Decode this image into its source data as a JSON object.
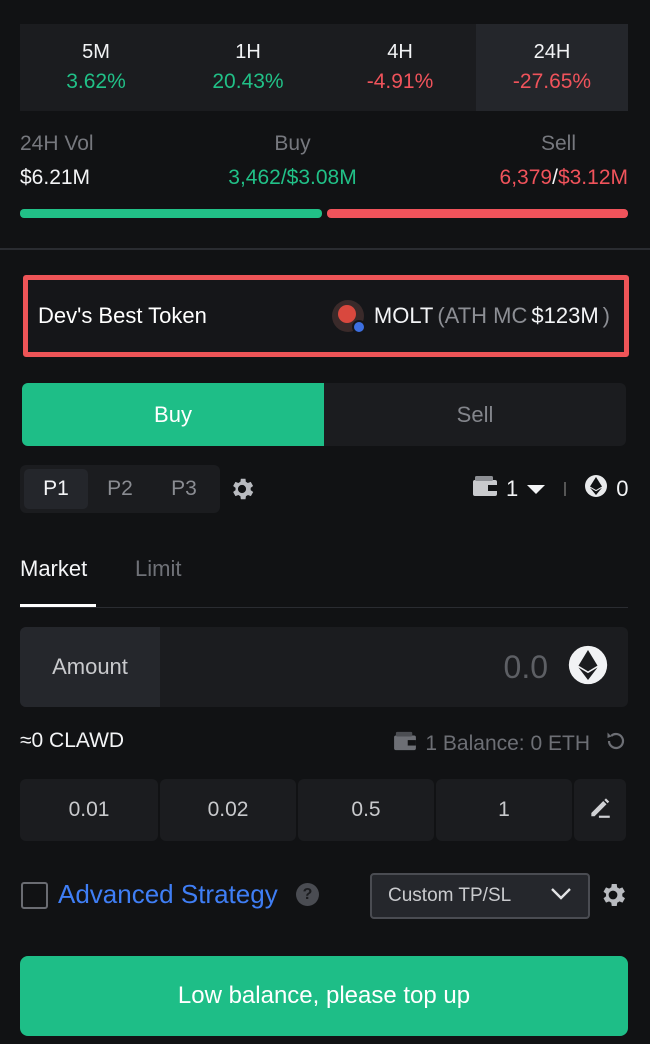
{
  "timeframes": [
    {
      "label": "5M",
      "change": "3.62%",
      "trend": "up"
    },
    {
      "label": "1H",
      "change": "20.43%",
      "trend": "up"
    },
    {
      "label": "4H",
      "change": "-4.91%",
      "trend": "down"
    },
    {
      "label": "24H",
      "change": "-27.65%",
      "trend": "down",
      "active": true
    }
  ],
  "volume": {
    "vol_label": "24H Vol",
    "vol_value": "$6.21M",
    "buy_label": "Buy",
    "buy_count": "3,462",
    "buy_sep": "/",
    "buy_amount": "$3.08M",
    "sell_label": "Sell",
    "sell_count": "6,379",
    "sell_sep": "/",
    "sell_amount": "$3.12M",
    "buy_share": 0.497
  },
  "best_token": {
    "title": "Dev's Best Token",
    "symbol": "MOLT",
    "ath_prefix": "(ATH MC",
    "ath_value": "$123M",
    "ath_suffix": ")"
  },
  "side": {
    "buy_label": "Buy",
    "sell_label": "Sell"
  },
  "presets": [
    "P1",
    "P2",
    "P3"
  ],
  "wallet": {
    "count": "1",
    "eth_balance": "0"
  },
  "order_tabs": {
    "market": "Market",
    "limit": "Limit"
  },
  "amount": {
    "label": "Amount",
    "placeholder": "0.0"
  },
  "estimate": {
    "received": "≈0 CLAWD",
    "balance": "1 Balance: 0 ETH"
  },
  "quick_amounts": [
    "0.01",
    "0.02",
    "0.5",
    "1"
  ],
  "advanced": {
    "label": "Advanced Strategy",
    "help": "?",
    "select_value": "Custom TP/SL"
  },
  "cta_label": "Low balance, please top up",
  "colors": {
    "positive": "#21c087",
    "negative": "#f0535b",
    "accent": "#1ebe87",
    "link": "#3f7ef5"
  }
}
